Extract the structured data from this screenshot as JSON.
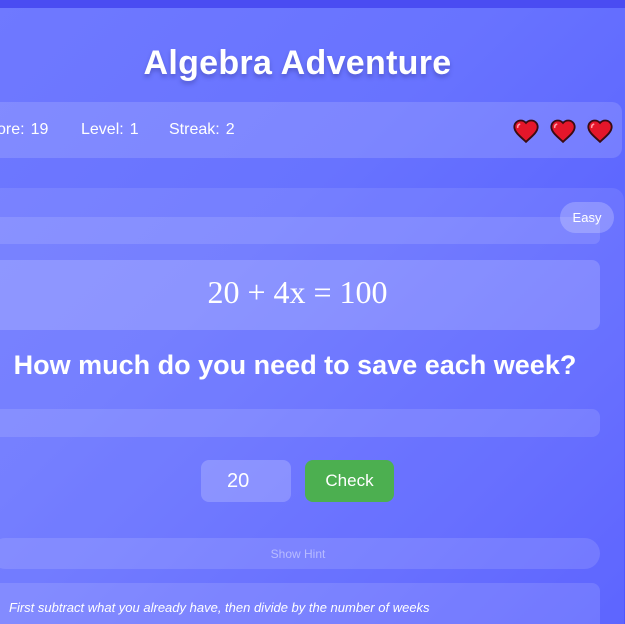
{
  "game": {
    "title": "Algebra Adventure"
  },
  "stats": {
    "score_label": "ore:",
    "score_value": "19",
    "level_label": "Level:",
    "level_value": "1",
    "streak_label": "Streak:",
    "streak_value": "2",
    "lives": 3
  },
  "puzzle": {
    "difficulty": "Easy",
    "equation": "20 + 4x = 100",
    "question": "How much do you need to save each week?"
  },
  "answer": {
    "input_value": "20",
    "check_label": "Check"
  },
  "hint": {
    "button_label": "Show Hint",
    "text": "First subtract what you already have, then divide by the number of weeks"
  },
  "colors": {
    "background": "#5e67ff",
    "check_button": "#4caf50",
    "heart": "#e5162a"
  }
}
